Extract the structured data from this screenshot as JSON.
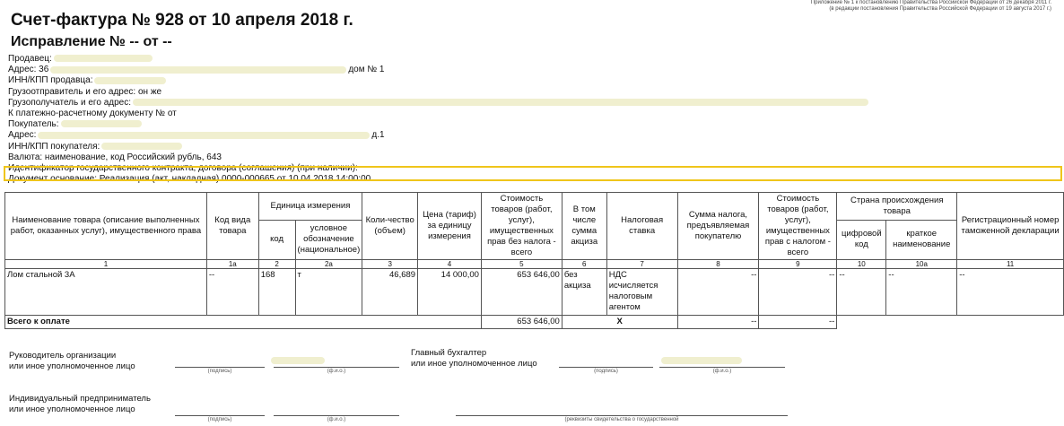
{
  "corner_note": [
    "Приложение № 1 к постановлению Правительства Российской Федерации от 26 декабря 2011 г.",
    "(в редакции постановления Правительства Российской Федерации от 19 августа 2017 г.)"
  ],
  "title": "Счет-фактура № 928 от 10 апреля 2018 г.",
  "subtitle": "Исправление № -- от --",
  "fields": {
    "seller_label": "Продавец:",
    "address_label": "Адрес: 36",
    "address_tail": "дом № 1",
    "inn_seller_label": "ИНН/КПП продавца:",
    "shipper": "Грузоотправитель и его адрес: он же",
    "consignee_label": "Грузополучатель и его адрес:",
    "payment_doc": "К платежно-расчетному документу №",
    "payment_doc_from": "от",
    "buyer_label": "Покупатель:",
    "buyer_address_label": "Адрес:",
    "buyer_address_tail": "д.1",
    "inn_buyer_label": "ИНН/КПП покупателя:",
    "currency": "Валюта: наименование, код Российский рубль, 643",
    "gov_contract": "Идентификатор государственного контракта, договора (соглашения) (при наличии):",
    "basis_doc": "Документ основание: Реализация (акт, накладная) 0000-000665 от 10.04.2018 14:00:00"
  },
  "table": {
    "headers": {
      "name": "Наименование товара (описание выполненных работ, оказанных услуг), имущественного права",
      "kind_code": "Код вида товара",
      "unit": "Единица измерения",
      "unit_code": "код",
      "unit_name": "условное обозначение (национальное)",
      "qty": "Коли-чество (объем)",
      "price": "Цена (тариф) за единицу измерения",
      "cost_no_tax": "Стоимость товаров (работ, услуг), имущественных прав без налога - всего",
      "excise": "В том числе сумма акциза",
      "tax_rate": "Налоговая ставка",
      "tax_sum": "Сумма налога, предъявляемая покупателю",
      "cost_with_tax": "Стоимость товаров (работ, услуг), имущественных прав с налогом - всего",
      "country": "Страна происхождения товара",
      "country_code": "цифровой код",
      "country_name": "краткое наименование",
      "customs": "Регистрационный номер таможенной декларации"
    },
    "col_numbers": [
      "1",
      "1а",
      "2",
      "2а",
      "3",
      "4",
      "5",
      "6",
      "7",
      "8",
      "9",
      "10",
      "10а",
      "11"
    ],
    "row": {
      "name": "Лом стальной 3А",
      "kind_code": "--",
      "unit_code": "168",
      "unit_name": "т",
      "qty": "46,689",
      "price": "14 000,00",
      "cost_no_tax": "653 646,00",
      "excise": "без акциза",
      "tax_rate": "НДС исчисляется налоговым агентом",
      "tax_sum": "--",
      "cost_with_tax": "--",
      "country_code": "--",
      "country_name": "--",
      "customs": "--"
    },
    "total": {
      "label": "Всего к оплате",
      "cost_no_tax": "653 646,00",
      "excise": "X",
      "tax_sum": "--",
      "cost_with_tax": "--"
    }
  },
  "signatures": {
    "head_line1": "Руководитель организации",
    "head_line2": "или иное уполномоченное лицо",
    "chief_acc_line1": "Главный бухгалтер",
    "chief_acc_line2": "или иное уполномоченное лицо",
    "entrepreneur_line1": "Индивидуальный предприниматель",
    "entrepreneur_line2": "или иное уполномоченное лицо",
    "cap_signature": "(подпись)",
    "cap_name": "(ф.и.о.)",
    "cap_cert": "(реквизиты свидетельства о государственной"
  }
}
